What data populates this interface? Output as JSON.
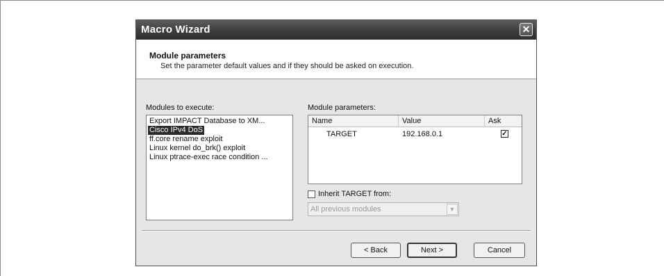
{
  "window": {
    "title": "Macro Wizard",
    "close_glyph": "✕"
  },
  "header": {
    "title": "Module parameters",
    "subtitle": "Set the parameter default values and if they should be asked on execution."
  },
  "modules": {
    "label": "Modules to execute:",
    "items": [
      "Export IMPACT Database to XM...",
      "Cisco IPv4 DoS",
      "ff.core rename exploit",
      "Linux kernel do_brk() exploit",
      "Linux ptrace-exec race condition ..."
    ],
    "selected_index": 1
  },
  "parameters": {
    "label": "Module parameters:",
    "columns": [
      "Name",
      "Value",
      "Ask"
    ],
    "rows": [
      {
        "name": "TARGET",
        "value": "192.168.0.1",
        "ask": true
      }
    ]
  },
  "inherit": {
    "label": "Inherit TARGET from:",
    "checked": false,
    "combo_value": "All previous modules",
    "combo_enabled": false
  },
  "buttons": {
    "back": "< Back",
    "next": "Next >",
    "cancel": "Cancel"
  },
  "icons": {
    "close": "close-icon",
    "check": "checkmark-icon",
    "dropdown": "chevron-down-icon"
  }
}
